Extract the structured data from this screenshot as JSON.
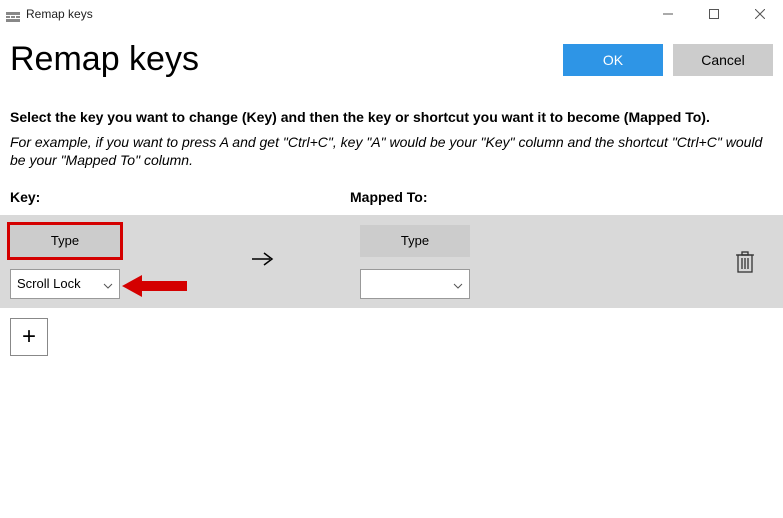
{
  "window": {
    "title": "Remap keys"
  },
  "header": {
    "page_title": "Remap keys",
    "ok_label": "OK",
    "cancel_label": "Cancel"
  },
  "instructions": {
    "bold_line": "Select the key you want to change (Key) and then the key or shortcut you want it to become (Mapped To).",
    "italic_line": "For example, if you want to press A and get \"Ctrl+C\", key \"A\" would be your \"Key\" column and the shortcut \"Ctrl+C\" would be your \"Mapped To\" column."
  },
  "columns": {
    "key_header": "Key:",
    "mapped_header": "Mapped To:"
  },
  "row": {
    "key_type_label": "Type",
    "key_dropdown_value": "Scroll Lock",
    "mapped_type_label": "Type",
    "mapped_dropdown_value": ""
  },
  "icons": {
    "add": "+"
  },
  "annotations": {
    "highlight_key_type": true,
    "red_arrow_points_to_key_dropdown": true
  },
  "colors": {
    "accent": "#2e95e6",
    "highlight": "#d40000",
    "row_bg": "#d9d9d9",
    "btn_gray": "#cccccc"
  }
}
